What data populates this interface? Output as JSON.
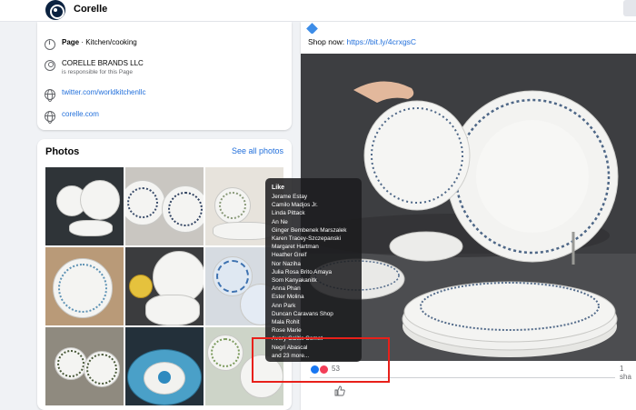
{
  "header": {
    "page_name": "Corelle"
  },
  "intro": {
    "page_type_label": "Page",
    "page_type_value": "Kitchen/cooking",
    "owner_name": "CORELLE BRANDS LLC",
    "owner_sub": "is responsible for this Page",
    "twitter_link": "twitter.com/worldkitchenllc",
    "website_link": "corelle.com"
  },
  "photos": {
    "title": "Photos",
    "see_all": "See all photos"
  },
  "post": {
    "shop_now_label": "Shop now:",
    "shop_now_link": "https://bit.ly/4crxgsC",
    "reaction_count": "53",
    "share_count": "1 sha"
  },
  "tooltip": {
    "title": "Like",
    "names": [
      "Jerame Estay",
      "Camilo Madjos Jr.",
      "Linda Pittack",
      "An Ne",
      "Ginger Bembenek Marszalek",
      "Karen Tracey-Szczepanski",
      "Margaret Hartman",
      "Heather Greif",
      "Nor Naziha",
      "Julia Rosa Brito Amaya",
      "Som Kanyakanitk",
      "Anna Phan",
      "Ester Molina",
      "Ann Park",
      "Duncan Caravans Shop",
      "Mala Rohit",
      "Rose Marie",
      "Avery Calitis Comet",
      "Negri Abascal"
    ],
    "more": "and 23 more..."
  },
  "colors": {
    "link": "#216fdb",
    "highlight": "#e8201a",
    "like_blue": "#1877f2",
    "love_red": "#f33e58"
  }
}
